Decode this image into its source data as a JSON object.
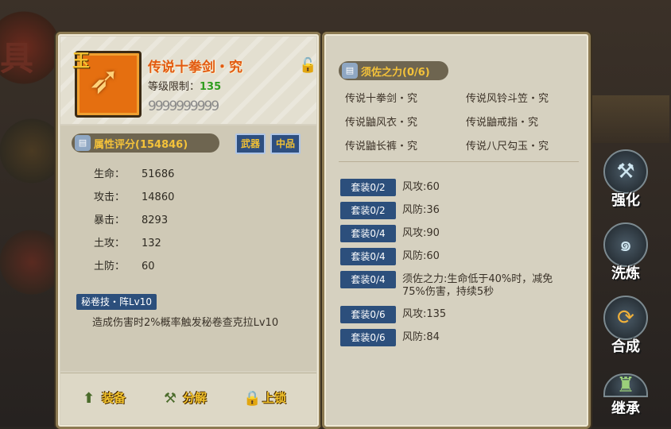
{
  "bg": {
    "char": "具"
  },
  "item": {
    "grade_badge": "玉",
    "name": "传说十拳剑・究",
    "level_label": "等级限制：",
    "level_value": "135",
    "beads": "9999999999"
  },
  "attributes": {
    "title": "属性评分(154846)",
    "tag_type": "武器",
    "tag_grade": "中品",
    "stats": [
      {
        "k": "生命：",
        "v": "51686"
      },
      {
        "k": "攻击：",
        "v": "14860"
      },
      {
        "k": "暴击：",
        "v": "8293"
      },
      {
        "k": "土攻：",
        "v": "132"
      },
      {
        "k": "土防：",
        "v": "60"
      }
    ],
    "skill_title": "秘卷技・阵Lv10",
    "skill_desc": "造成伤害时2%概率触发秘卷查克拉Lv10"
  },
  "buttons": {
    "equip": "装备",
    "decompose": "分解",
    "lock": "上锁"
  },
  "set": {
    "title": "须佐之力(0/6)",
    "items": [
      "传说十拳剑・究",
      "传说风铃斗笠・究",
      "传说鼬风衣・究",
      "传说鼬戒指・究",
      "传说鼬长裤・究",
      "传说八尺勾玉・究"
    ],
    "bonuses": [
      {
        "tag": "套装0/2",
        "desc": "风攻:60"
      },
      {
        "tag": "套装0/2",
        "desc": "风防:36"
      },
      {
        "tag": "套装0/4",
        "desc": "风攻:90"
      },
      {
        "tag": "套装0/4",
        "desc": "风防:60"
      },
      {
        "tag": "套装0/4",
        "desc": "须佐之力:生命低于40%时，减免75%伤害，持续5秒"
      },
      {
        "tag": "套装0/6",
        "desc": "风攻:135"
      },
      {
        "tag": "套装0/6",
        "desc": "风防:84"
      }
    ]
  },
  "side_menu": {
    "strengthen": "强化",
    "refine": "洗炼",
    "synthesize": "合成",
    "inherit": "继承"
  }
}
